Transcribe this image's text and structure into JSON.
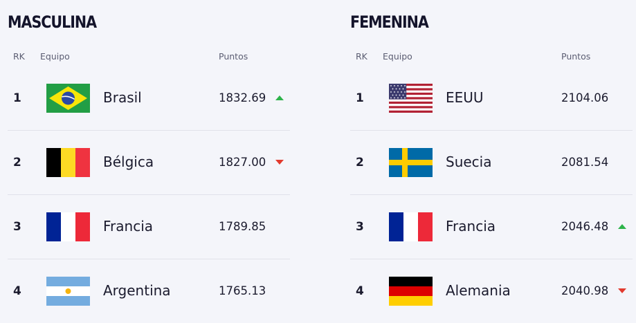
{
  "columns": {
    "rank": "RK",
    "team": "Equipo",
    "points": "Puntos"
  },
  "colors": {
    "up": "#2db34a",
    "down": "#e23a2e",
    "divider": "#e0e1ea",
    "background": "#f4f5fa"
  },
  "masculina": {
    "title": "MASCULINA",
    "rows": [
      {
        "rank": "1",
        "team": "Brasil",
        "points": "1832.69",
        "trend": "up",
        "flag": "brazil-flag-icon"
      },
      {
        "rank": "2",
        "team": "Bélgica",
        "points": "1827.00",
        "trend": "down",
        "flag": "belgium-flag-icon"
      },
      {
        "rank": "3",
        "team": "Francia",
        "points": "1789.85",
        "trend": "none",
        "flag": "france-flag-icon"
      },
      {
        "rank": "4",
        "team": "Argentina",
        "points": "1765.13",
        "trend": "none",
        "flag": "argentina-flag-icon"
      }
    ]
  },
  "femenina": {
    "title": "FEMENINA",
    "rows": [
      {
        "rank": "1",
        "team": "EEUU",
        "points": "2104.06",
        "trend": "none",
        "flag": "usa-flag-icon"
      },
      {
        "rank": "2",
        "team": "Suecia",
        "points": "2081.54",
        "trend": "none",
        "flag": "sweden-flag-icon"
      },
      {
        "rank": "3",
        "team": "Francia",
        "points": "2046.48",
        "trend": "up",
        "flag": "france-flag-icon"
      },
      {
        "rank": "4",
        "team": "Alemania",
        "points": "2040.98",
        "trend": "down",
        "flag": "germany-flag-icon"
      }
    ]
  }
}
